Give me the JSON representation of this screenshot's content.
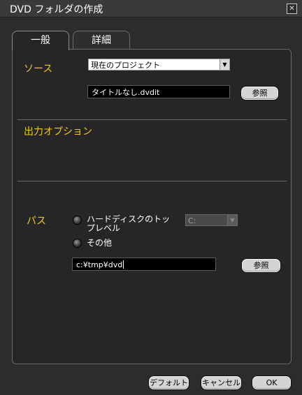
{
  "window": {
    "title": "DVD フォルダの作成",
    "close_glyph": "✕"
  },
  "tabs": [
    {
      "label": "一般",
      "active": true
    },
    {
      "label": "詳細",
      "active": false
    }
  ],
  "source": {
    "label": "ソース",
    "select_value": "現在のプロジェクト",
    "file_value": "タイトルなし.dvdit",
    "browse_label": "参照"
  },
  "output_options": {
    "label": "出力オプション"
  },
  "path": {
    "label": "パス",
    "radio_hdd_label_line1": "ハードディスクのトッ",
    "radio_hdd_label_line2": "プレベル",
    "drive_value": "C:",
    "radio_other_label": "その他",
    "path_value": "c:¥tmp¥dvd",
    "browse_label": "参照"
  },
  "footer": {
    "default_label": "デフォルト",
    "cancel_label": "キャンセル",
    "ok_label": "OK"
  },
  "colors": {
    "background": "#2c2c2e",
    "accent_label": "#f2c81e"
  }
}
